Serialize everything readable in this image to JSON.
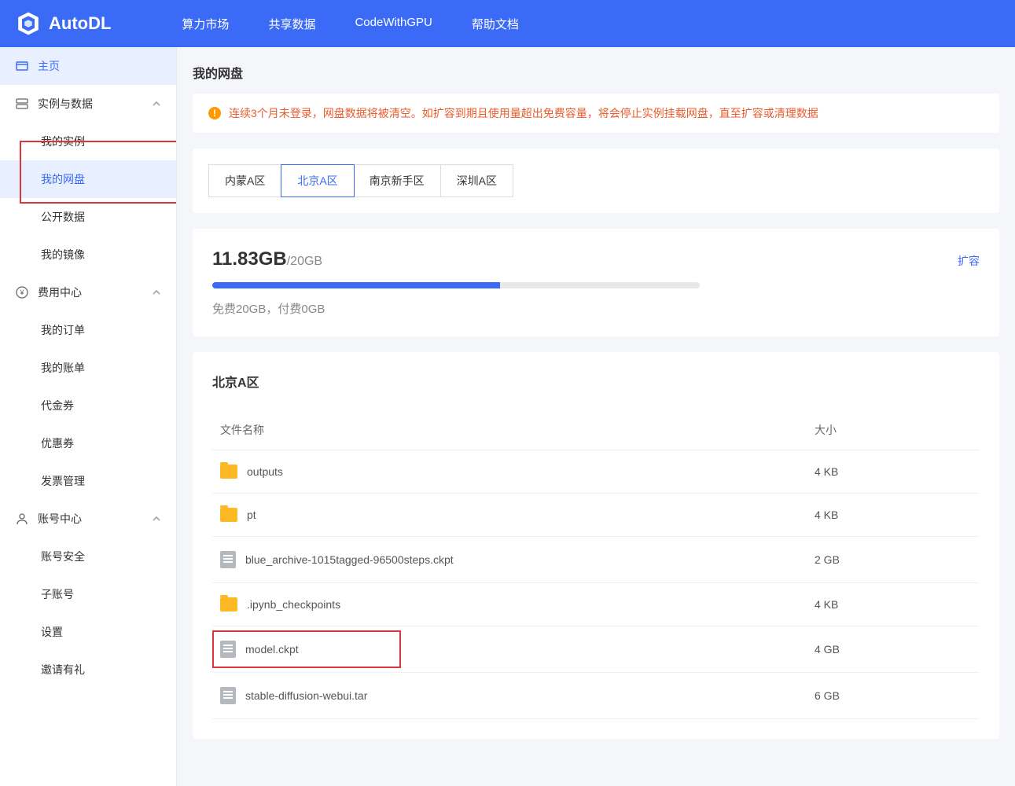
{
  "brand": {
    "name": "AutoDL"
  },
  "nav": {
    "items": [
      {
        "label": "算力市场"
      },
      {
        "label": "共享数据"
      },
      {
        "label": "CodeWithGPU"
      },
      {
        "label": "帮助文档"
      }
    ]
  },
  "sidebar": {
    "home": "主页",
    "groups": [
      {
        "label": "实例与数据",
        "items": [
          {
            "label": "我的实例"
          },
          {
            "label": "我的网盘",
            "active": true
          },
          {
            "label": "公开数据"
          },
          {
            "label": "我的镜像"
          }
        ]
      },
      {
        "label": "费用中心",
        "items": [
          {
            "label": "我的订单"
          },
          {
            "label": "我的账单"
          },
          {
            "label": "代金券"
          },
          {
            "label": "优惠券"
          },
          {
            "label": "发票管理"
          }
        ]
      },
      {
        "label": "账号中心",
        "items": [
          {
            "label": "账号安全"
          },
          {
            "label": "子账号"
          },
          {
            "label": "设置"
          },
          {
            "label": "邀请有礼"
          }
        ]
      }
    ]
  },
  "page": {
    "title": "我的网盘",
    "warning": "连续3个月未登录，网盘数据将被清空。如扩容到期且使用量超出免费容量，将会停止实例挂载网盘，直至扩容或清理数据",
    "regions": {
      "tabs": [
        {
          "label": "内蒙A区"
        },
        {
          "label": "北京A区",
          "active": true
        },
        {
          "label": "南京新手区"
        },
        {
          "label": "深圳A区"
        }
      ]
    },
    "storage": {
      "used": "11.83GB",
      "total": "/20GB",
      "expand_label": "扩容",
      "progress_percent": 59,
      "detail": "免费20GB，付费0GB"
    },
    "files": {
      "region": "北京A区",
      "headers": {
        "name": "文件名称",
        "size": "大小"
      },
      "rows": [
        {
          "type": "folder",
          "name": "outputs",
          "size": "4 KB"
        },
        {
          "type": "folder",
          "name": "pt",
          "size": "4 KB"
        },
        {
          "type": "file",
          "name": "blue_archive-1015tagged-96500steps.ckpt",
          "size": "2 GB"
        },
        {
          "type": "folder",
          "name": ".ipynb_checkpoints",
          "size": "4 KB"
        },
        {
          "type": "file",
          "name": "model.ckpt",
          "size": "4 GB",
          "highlighted": true
        },
        {
          "type": "file",
          "name": "stable-diffusion-webui.tar",
          "size": "6 GB"
        }
      ]
    }
  }
}
